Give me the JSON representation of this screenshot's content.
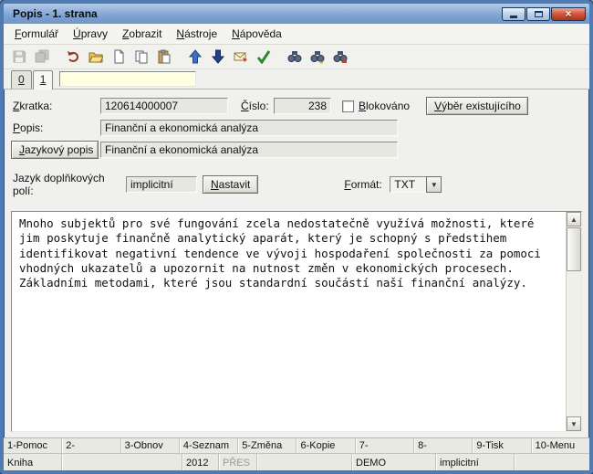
{
  "window": {
    "title": "Popis - 1. strana"
  },
  "colors": {
    "titlebar_blue": "#7ea3d2",
    "close_red": "#b52f12",
    "field_gray": "#e7e7e1",
    "filter_yellow": "#ffffe1"
  },
  "menu": {
    "items": [
      "Formulář",
      "Úpravy",
      "Zobrazit",
      "Nástroje",
      "Nápověda"
    ]
  },
  "toolbar": {
    "icons": [
      "save-icon",
      "save-all-icon",
      "undo-icon",
      "open-icon",
      "new-document-icon",
      "copy-icon",
      "paste-icon",
      "move-up-icon",
      "move-down-icon",
      "mail-icon",
      "spell-check-icon",
      "find-icon",
      "find-next-icon",
      "find-replace-icon"
    ]
  },
  "tabs": {
    "items": [
      "0",
      "1"
    ],
    "active": "1",
    "filter_value": ""
  },
  "form": {
    "zkratka_label": "Zkratka:",
    "zkratka_value": "120614000007",
    "cislo_label": "Číslo:",
    "cislo_value": "238",
    "blokovano_label": "Blokováno",
    "vyber_button": "Výběr existujícího",
    "popis_label": "Popis:",
    "popis_value": "Finanční a ekonomická analýza",
    "jazykovy_popis_button": "Jazykový popis",
    "jazykovy_popis_value": "Finanční a ekonomická analýza",
    "jazyk_label": "Jazyk doplňkových polí:",
    "jazyk_value": "implicitní",
    "nastavit_button": "Nastavit",
    "format_label": "Formát:",
    "format_value": "TXT"
  },
  "editor": {
    "text": "Mnoho subjektů pro své fungování zcela nedostatečně využívá možnosti, které jim poskytuje finančně analytický aparát, který je schopný s předstihem identifikovat negativní tendence ve vývoji hospodaření společnosti za pomoci vhodných ukazatelů a upozornit na nutnost změn v ekonomických procesech. Základními metodami, které jsou standardní součástí naší finanční analýzy."
  },
  "function_bar": {
    "keys": [
      "1-Pomoc",
      "2-",
      "3-Obnov",
      "4-Seznam",
      "5-Změna",
      "6-Kopie",
      "7-",
      "8-",
      "9-Tisk",
      "10-Menu"
    ]
  },
  "status_bar": {
    "cells": [
      "Kniha",
      "",
      "2012",
      "PŘES",
      "",
      "DEMO",
      "implicitní",
      ""
    ]
  }
}
